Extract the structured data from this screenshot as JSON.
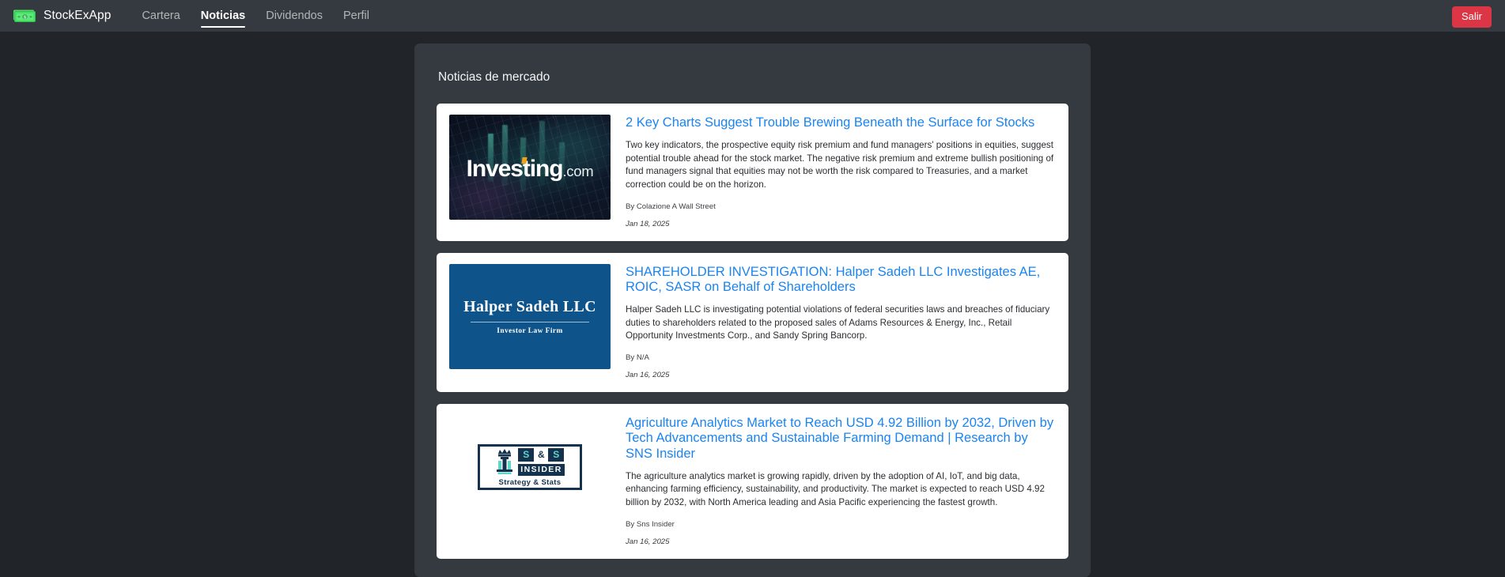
{
  "navbar": {
    "brand": {
      "logo_icon": "money-banknote-icon",
      "name": "StockExApp"
    },
    "links": [
      {
        "label": "Cartera",
        "active": false
      },
      {
        "label": "Noticias",
        "active": true
      },
      {
        "label": "Dividendos",
        "active": false
      },
      {
        "label": "Perfil",
        "active": false
      }
    ],
    "logout_label": "Salir",
    "logout_color": "#dc3545",
    "background": "#343a40"
  },
  "panel": {
    "title": "Noticias de mercado",
    "background": "#343a40"
  },
  "page": {
    "background": "#212529"
  },
  "theme": {
    "link_color": "#1a84f0",
    "card_background": "#ffffff"
  },
  "news": [
    {
      "thumb_kind": "investing-com-logo-image",
      "thumb_text": {
        "word": "Investing",
        "suffix": ".com"
      },
      "title": "2 Key Charts Suggest Trouble Brewing Beneath the Surface for Stocks",
      "description": "Two key indicators, the prospective equity risk premium and fund managers' positions in equities, suggest potential trouble ahead for the stock market. The negative risk premium and extreme bullish positioning of fund managers signal that equities may not be worth the risk compared to Treasuries, and a market correction could be on the horizon.",
      "author": "By Colazione A Wall Street",
      "date": "Jan 18, 2025"
    },
    {
      "thumb_kind": "halper-sadeh-logo-image",
      "thumb_text": {
        "name": "Halper Sadeh LLC",
        "sub": "Investor Law Firm"
      },
      "title": "SHAREHOLDER INVESTIGATION: Halper Sadeh LLC Investigates AE, ROIC, SASR on Behalf of Shareholders",
      "description": "Halper Sadeh LLC is investigating potential violations of federal securities laws and breaches of fiduciary duties to shareholders related to the proposed sales of Adams Resources & Energy, Inc., Retail Opportunity Investments Corp., and Sandy Spring Bancorp.",
      "author": "By N/A",
      "date": "Jan 16, 2025"
    },
    {
      "thumb_kind": "sns-insider-logo-image",
      "thumb_text": {
        "s1": "S",
        "amp": "&",
        "s2": "S",
        "insider": "INSIDER",
        "tagline": "Strategy & Stats"
      },
      "title": "Agriculture Analytics Market to Reach USD 4.92 Billion by 2032, Driven by Tech Advancements and Sustainable Farming Demand | Research by SNS Insider",
      "description": "The agriculture analytics market is growing rapidly, driven by the adoption of AI, IoT, and big data, enhancing farming efficiency, sustainability, and productivity. The market is expected to reach USD 4.92 billion by 2032, with North America leading and Asia Pacific experiencing the fastest growth.",
      "author": "By Sns Insider",
      "date": "Jan 16, 2025"
    }
  ]
}
